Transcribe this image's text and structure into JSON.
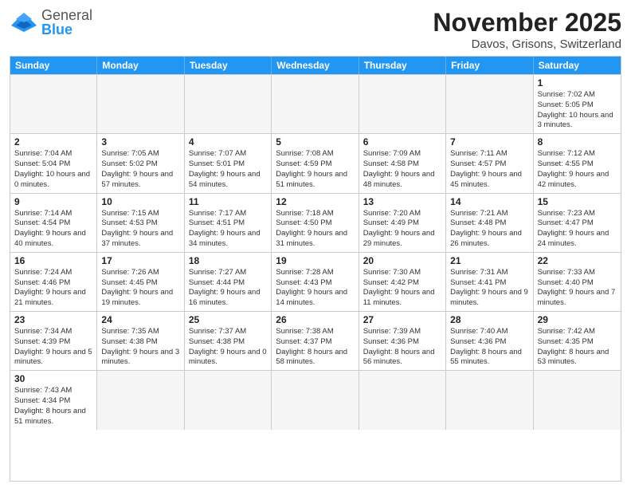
{
  "logo": {
    "general": "General",
    "blue": "Blue"
  },
  "title": "November 2025",
  "location": "Davos, Grisons, Switzerland",
  "header_days": [
    "Sunday",
    "Monday",
    "Tuesday",
    "Wednesday",
    "Thursday",
    "Friday",
    "Saturday"
  ],
  "weeks": [
    [
      {
        "day": "",
        "info": ""
      },
      {
        "day": "",
        "info": ""
      },
      {
        "day": "",
        "info": ""
      },
      {
        "day": "",
        "info": ""
      },
      {
        "day": "",
        "info": ""
      },
      {
        "day": "",
        "info": ""
      },
      {
        "day": "1",
        "info": "Sunrise: 7:02 AM\nSunset: 5:05 PM\nDaylight: 10 hours and 3 minutes."
      }
    ],
    [
      {
        "day": "2",
        "info": "Sunrise: 7:04 AM\nSunset: 5:04 PM\nDaylight: 10 hours and 0 minutes."
      },
      {
        "day": "3",
        "info": "Sunrise: 7:05 AM\nSunset: 5:02 PM\nDaylight: 9 hours and 57 minutes."
      },
      {
        "day": "4",
        "info": "Sunrise: 7:07 AM\nSunset: 5:01 PM\nDaylight: 9 hours and 54 minutes."
      },
      {
        "day": "5",
        "info": "Sunrise: 7:08 AM\nSunset: 4:59 PM\nDaylight: 9 hours and 51 minutes."
      },
      {
        "day": "6",
        "info": "Sunrise: 7:09 AM\nSunset: 4:58 PM\nDaylight: 9 hours and 48 minutes."
      },
      {
        "day": "7",
        "info": "Sunrise: 7:11 AM\nSunset: 4:57 PM\nDaylight: 9 hours and 45 minutes."
      },
      {
        "day": "8",
        "info": "Sunrise: 7:12 AM\nSunset: 4:55 PM\nDaylight: 9 hours and 42 minutes."
      }
    ],
    [
      {
        "day": "9",
        "info": "Sunrise: 7:14 AM\nSunset: 4:54 PM\nDaylight: 9 hours and 40 minutes."
      },
      {
        "day": "10",
        "info": "Sunrise: 7:15 AM\nSunset: 4:53 PM\nDaylight: 9 hours and 37 minutes."
      },
      {
        "day": "11",
        "info": "Sunrise: 7:17 AM\nSunset: 4:51 PM\nDaylight: 9 hours and 34 minutes."
      },
      {
        "day": "12",
        "info": "Sunrise: 7:18 AM\nSunset: 4:50 PM\nDaylight: 9 hours and 31 minutes."
      },
      {
        "day": "13",
        "info": "Sunrise: 7:20 AM\nSunset: 4:49 PM\nDaylight: 9 hours and 29 minutes."
      },
      {
        "day": "14",
        "info": "Sunrise: 7:21 AM\nSunset: 4:48 PM\nDaylight: 9 hours and 26 minutes."
      },
      {
        "day": "15",
        "info": "Sunrise: 7:23 AM\nSunset: 4:47 PM\nDaylight: 9 hours and 24 minutes."
      }
    ],
    [
      {
        "day": "16",
        "info": "Sunrise: 7:24 AM\nSunset: 4:46 PM\nDaylight: 9 hours and 21 minutes."
      },
      {
        "day": "17",
        "info": "Sunrise: 7:26 AM\nSunset: 4:45 PM\nDaylight: 9 hours and 19 minutes."
      },
      {
        "day": "18",
        "info": "Sunrise: 7:27 AM\nSunset: 4:44 PM\nDaylight: 9 hours and 16 minutes."
      },
      {
        "day": "19",
        "info": "Sunrise: 7:28 AM\nSunset: 4:43 PM\nDaylight: 9 hours and 14 minutes."
      },
      {
        "day": "20",
        "info": "Sunrise: 7:30 AM\nSunset: 4:42 PM\nDaylight: 9 hours and 11 minutes."
      },
      {
        "day": "21",
        "info": "Sunrise: 7:31 AM\nSunset: 4:41 PM\nDaylight: 9 hours and 9 minutes."
      },
      {
        "day": "22",
        "info": "Sunrise: 7:33 AM\nSunset: 4:40 PM\nDaylight: 9 hours and 7 minutes."
      }
    ],
    [
      {
        "day": "23",
        "info": "Sunrise: 7:34 AM\nSunset: 4:39 PM\nDaylight: 9 hours and 5 minutes."
      },
      {
        "day": "24",
        "info": "Sunrise: 7:35 AM\nSunset: 4:38 PM\nDaylight: 9 hours and 3 minutes."
      },
      {
        "day": "25",
        "info": "Sunrise: 7:37 AM\nSunset: 4:38 PM\nDaylight: 9 hours and 0 minutes."
      },
      {
        "day": "26",
        "info": "Sunrise: 7:38 AM\nSunset: 4:37 PM\nDaylight: 8 hours and 58 minutes."
      },
      {
        "day": "27",
        "info": "Sunrise: 7:39 AM\nSunset: 4:36 PM\nDaylight: 8 hours and 56 minutes."
      },
      {
        "day": "28",
        "info": "Sunrise: 7:40 AM\nSunset: 4:36 PM\nDaylight: 8 hours and 55 minutes."
      },
      {
        "day": "29",
        "info": "Sunrise: 7:42 AM\nSunset: 4:35 PM\nDaylight: 8 hours and 53 minutes."
      }
    ],
    [
      {
        "day": "30",
        "info": "Sunrise: 7:43 AM\nSunset: 4:34 PM\nDaylight: 8 hours and 51 minutes."
      },
      {
        "day": "",
        "info": ""
      },
      {
        "day": "",
        "info": ""
      },
      {
        "day": "",
        "info": ""
      },
      {
        "day": "",
        "info": ""
      },
      {
        "day": "",
        "info": ""
      },
      {
        "day": "",
        "info": ""
      }
    ]
  ]
}
